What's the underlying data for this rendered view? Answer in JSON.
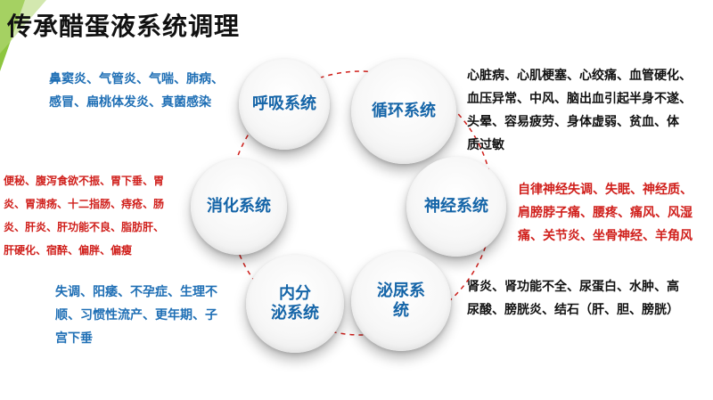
{
  "title": "传承醋蛋液系统调理",
  "colors": {
    "circle_text": "#1565a8",
    "ring_dash": "#d0201c",
    "accent_green": "#8dc63f"
  },
  "systems": {
    "respiratory": {
      "label": "呼吸系统",
      "desc": "鼻窦炎、气管炎、气喘、肺病、\n感冒、扁桃体发炎、真菌感染"
    },
    "circulatory": {
      "label": "循环系统",
      "desc": "心脏病、心肌梗塞、心绞痛、血管硬化、\n血压异常、中风、脑出血引起半身不遂、\n头晕、容易疲劳、身体虚弱、贫血、体\n质过敏"
    },
    "digestive": {
      "label": "消化系统",
      "desc": "便秘、腹泻食欲不振、胃下垂、胃\n炎、胃溃疡、十二指肠、痔疮、肠\n炎、肝炎、肝功能不良、脂肪肝、\n肝硬化、宿醉、偏胖、偏瘦"
    },
    "nervous": {
      "label": "神经系统",
      "desc": "自律神经失调、失眠、神经质、\n肩膀脖子痛、腰疼、痛风、风湿\n痛、关节炎、坐骨神经、羊角风"
    },
    "endocrine": {
      "label": "内分\n泌系统",
      "desc": "失调、阳痿、不孕症、生理不\n顺、习惯性流产、更年期、子\n宫下垂"
    },
    "urinary": {
      "label": "泌尿系\n统",
      "desc": "肾炎、肾功能不全、尿蛋白、水肿、高\n尿酸、膀胱炎、结石（肝、胆、膀胱）"
    }
  }
}
